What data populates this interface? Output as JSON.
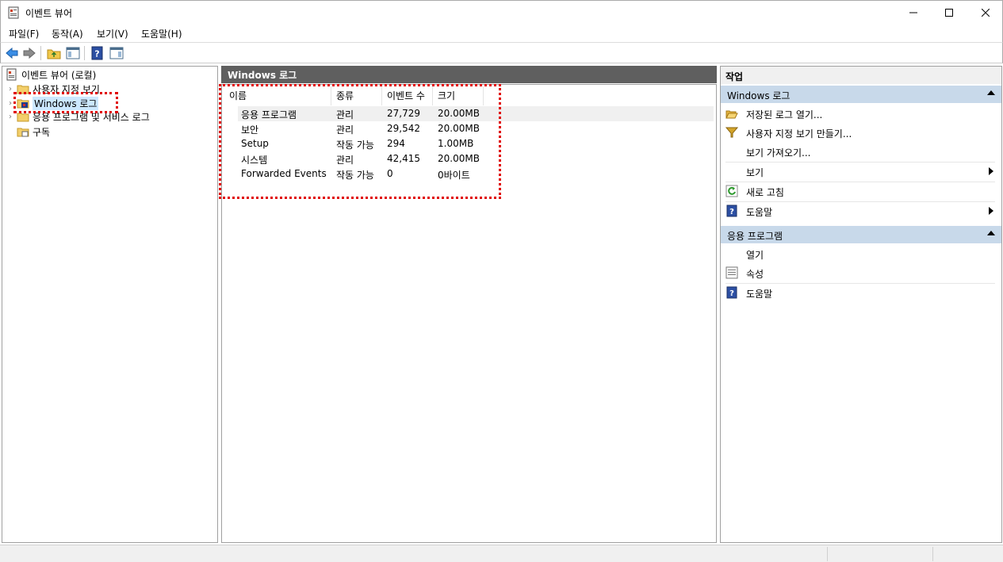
{
  "window": {
    "title": "이벤트 뷰어",
    "minimize": "—",
    "maximize": "☐",
    "close": "✕"
  },
  "menu": [
    "파일(F)",
    "동작(A)",
    "보기(V)",
    "도움말(H)"
  ],
  "toolbar": {
    "icons": [
      "back-arrow-icon",
      "forward-arrow-icon",
      "folder-up-icon",
      "show-hide-tree-icon",
      "help-icon",
      "show-hide-action-icon"
    ]
  },
  "tree": {
    "root": "이벤트 뷰어 (로컬)",
    "items": [
      {
        "label": "사용자 지정 보기",
        "icon": "folder-icon"
      },
      {
        "label": "Windows 로그",
        "icon": "windows-logs-icon"
      },
      {
        "label": "응용 프로그램 및 서비스 로그",
        "icon": "folder-icon"
      },
      {
        "label": "구독",
        "icon": "subscriptions-icon"
      }
    ]
  },
  "main": {
    "header": "Windows 로그",
    "columns": [
      "이름",
      "종류",
      "이벤트 수",
      "크기"
    ],
    "rows": [
      {
        "name": "응용 프로그램",
        "type": "관리",
        "count": "27,729",
        "size": "20.00MB"
      },
      {
        "name": "보안",
        "type": "관리",
        "count": "29,542",
        "size": "20.00MB"
      },
      {
        "name": "Setup",
        "type": "작동 가능",
        "count": "294",
        "size": "1.00MB"
      },
      {
        "name": "시스템",
        "type": "관리",
        "count": "42,415",
        "size": "20.00MB"
      },
      {
        "name": "Forwarded Events",
        "type": "작동 가능",
        "count": "0",
        "size": "0바이트"
      }
    ]
  },
  "actions": {
    "title": "작업",
    "section1": {
      "header": "Windows 로그",
      "items": [
        {
          "label": "저장된 로그 열기...",
          "icon": "open-folder-icon"
        },
        {
          "label": "사용자 지정 보기 만들기...",
          "icon": "filter-icon"
        },
        {
          "label": "보기 가져오기...",
          "icon": ""
        },
        {
          "label": "보기",
          "icon": "",
          "submenu": true
        },
        {
          "label": "새로 고침",
          "icon": "refresh-icon"
        },
        {
          "label": "도움말",
          "icon": "help-icon",
          "submenu": true
        }
      ]
    },
    "section2": {
      "header": "응용 프로그램",
      "items": [
        {
          "label": "열기",
          "icon": ""
        },
        {
          "label": "속성",
          "icon": "properties-icon"
        },
        {
          "label": "도움말",
          "icon": "help-icon"
        }
      ]
    }
  },
  "colors": {
    "header_dark": "#5f5f5f",
    "section_blue": "#c8d9ea",
    "highlight_red": "#e00000",
    "selection": "#cce8ff"
  }
}
